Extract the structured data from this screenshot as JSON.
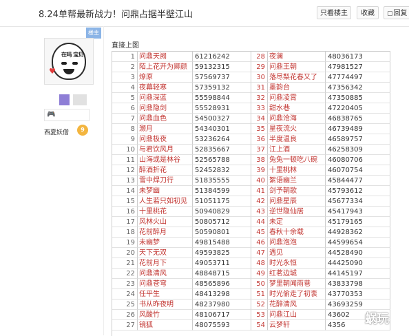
{
  "header": {
    "title": "8.24单帮最新战力！问鼎占据半壁江山",
    "buttons": {
      "only_op": "只看楼主",
      "favorite": "收藏",
      "reply": "回复"
    }
  },
  "post": {
    "floor_label": "楼主",
    "avatar_text": "在吗 宝贝",
    "username": "西夏妖僧",
    "level_badge": "9",
    "intro": "直接上图"
  },
  "ranking": [
    {
      "rank": "1",
      "name": "问鼎天阙",
      "power": "61216242",
      "rank2": "28",
      "name2": "夜澜",
      "power2": "48036173"
    },
    {
      "rank": "2",
      "name": "陌上花开为卿颜",
      "power": "59132315",
      "rank2": "29",
      "name2": "问鼎王朝",
      "power2": "47981527"
    },
    {
      "rank": "3",
      "name": "燎原",
      "power": "57569737",
      "rank2": "30",
      "name2": "落尽梨花春又了",
      "power2": "47774497"
    },
    {
      "rank": "4",
      "name": "夜幕轻寒",
      "power": "57359132",
      "rank2": "31",
      "name2": "墨韵台",
      "power2": "47356342"
    },
    {
      "rank": "5",
      "name": "问鼎深蓝",
      "power": "55598844",
      "rank2": "32",
      "name2": "问鼎凌霄",
      "power2": "47350885"
    },
    {
      "rank": "6",
      "name": "问鼎隐剑",
      "power": "55528931",
      "rank2": "33",
      "name2": "甜水巷",
      "power2": "47220405"
    },
    {
      "rank": "7",
      "name": "问鼎血色",
      "power": "54500327",
      "rank2": "34",
      "name2": "问鼎沧海",
      "power2": "46838765"
    },
    {
      "rank": "8",
      "name": "灏月",
      "power": "54340301",
      "rank2": "35",
      "name2": "星夜流火",
      "power2": "46739489"
    },
    {
      "rank": "9",
      "name": "问鼎极夜",
      "power": "53236264",
      "rank2": "36",
      "name2": "半度温良",
      "power2": "46589757"
    },
    {
      "rank": "10",
      "name": "与君饮风月",
      "power": "52835667",
      "rank2": "37",
      "name2": "江上酒",
      "power2": "46258309"
    },
    {
      "rank": "11",
      "name": "山海或是林谷",
      "power": "52565788",
      "rank2": "38",
      "name2": "兔兔一顿吃八碗",
      "power2": "46080706"
    },
    {
      "rank": "12",
      "name": "醉酒折花",
      "power": "52452832",
      "rank2": "39",
      "name2": "十里桃林",
      "power2": "46070754"
    },
    {
      "rank": "13",
      "name": "雪中焊刀行",
      "power": "51835555",
      "rank2": "40",
      "name2": "絮语幽兰",
      "power2": "45844477"
    },
    {
      "rank": "14",
      "name": "未梦幽",
      "power": "51384599",
      "rank2": "41",
      "name2": "剑予朝歌",
      "power2": "45793612"
    },
    {
      "rank": "15",
      "name": "人生若只如初见",
      "power": "51051175",
      "rank2": "42",
      "name2": "问鼎星辰",
      "power2": "45677334"
    },
    {
      "rank": "16",
      "name": "十里桃花",
      "power": "50940829",
      "rank2": "43",
      "name2": "逆世隐仙居",
      "power2": "45417943"
    },
    {
      "rank": "17",
      "name": "风林火山",
      "power": "50805712",
      "rank2": "44",
      "name2": "未定",
      "power2": "45179165"
    },
    {
      "rank": "18",
      "name": "花前醉月",
      "power": "50590801",
      "rank2": "45",
      "name2": "春秋十余载",
      "power2": "44928362"
    },
    {
      "rank": "19",
      "name": "未幽梦",
      "power": "49815488",
      "rank2": "46",
      "name2": "问鼎泡泡",
      "power2": "44599654"
    },
    {
      "rank": "20",
      "name": "天下无双",
      "power": "49593825",
      "rank2": "47",
      "name2": "遇见",
      "power2": "44528490"
    },
    {
      "rank": "21",
      "name": "花前月下",
      "power": "49053711",
      "rank2": "48",
      "name2": "时光永恒",
      "power2": "44425090"
    },
    {
      "rank": "22",
      "name": "问鼎清风",
      "power": "48848715",
      "rank2": "49",
      "name2": "红茗边城",
      "power2": "44145197"
    },
    {
      "rank": "23",
      "name": "问鼎苍穹",
      "power": "48565896",
      "rank2": "50",
      "name2": "梦里朝闻雨巷",
      "power2": "43833798"
    },
    {
      "rank": "24",
      "name": "任平生",
      "power": "48413298",
      "rank2": "51",
      "name2": "时光偷走了初衷",
      "power2": "43770353"
    },
    {
      "rank": "25",
      "name": "书从昨夜明",
      "power": "48237980",
      "rank2": "52",
      "name2": "花醉清风",
      "power2": "43693259"
    },
    {
      "rank": "26",
      "name": "风酸竹",
      "power": "48106717",
      "rank2": "53",
      "name2": "问鼎江山",
      "power2": "43602"
    },
    {
      "rank": "27",
      "name": "镜狐",
      "power": "48075593",
      "rank2": "54",
      "name2": "云梦轩",
      "power2": "4356"
    }
  ],
  "watermark": "蜗玩"
}
